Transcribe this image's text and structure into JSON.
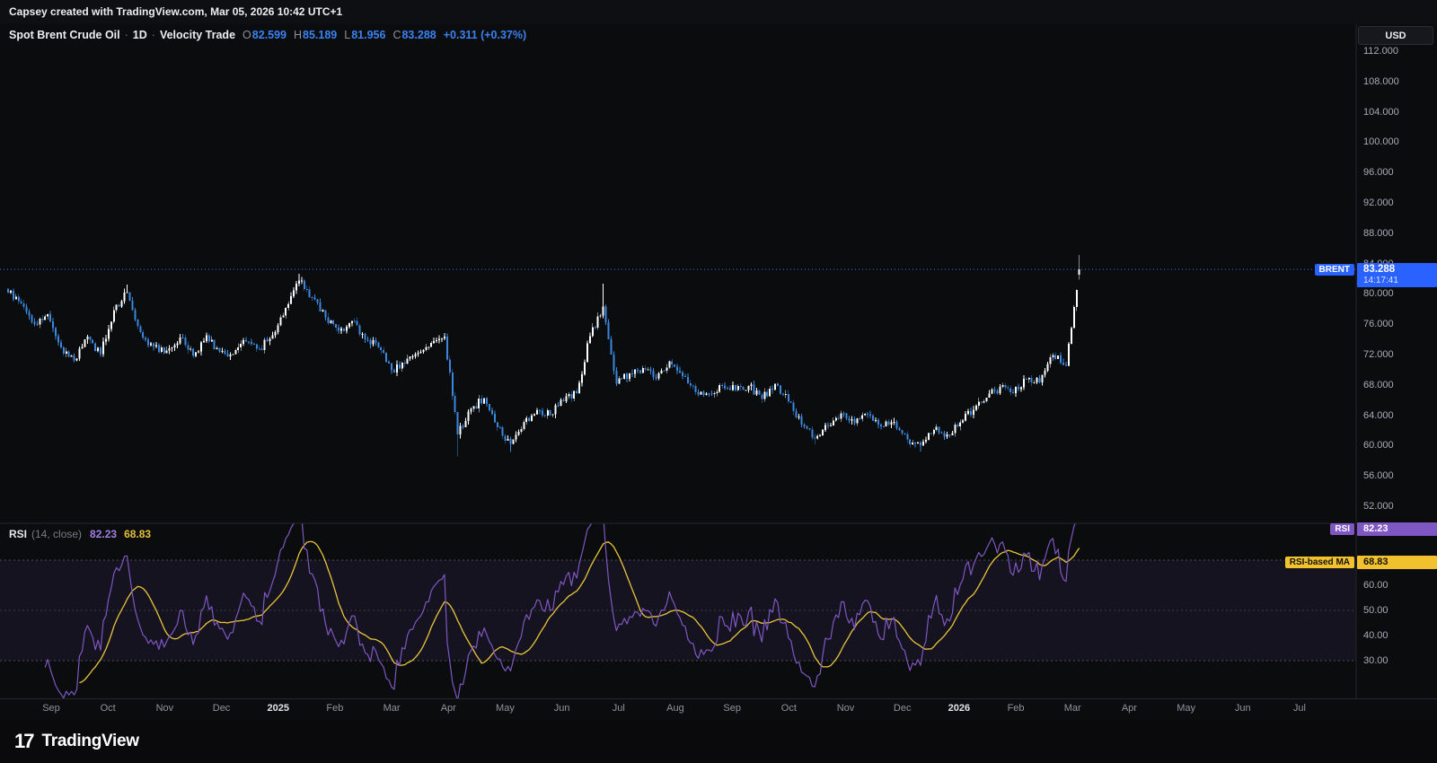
{
  "topbar": {
    "text": "Capsey created with TradingView.com, Mar 05, 2026 10:42 UTC+1"
  },
  "legend": {
    "symbol": "Spot Brent Crude Oil",
    "sep": "·",
    "interval": "1D",
    "exchange": "Velocity Trade",
    "ohlc": {
      "o_label": "O",
      "o": "82.599",
      "h_label": "H",
      "h": "85.189",
      "l_label": "L",
      "l": "81.956",
      "c_label": "C",
      "c": "83.288",
      "change": "+0.311 (+0.37%)"
    }
  },
  "currency_button": {
    "label": "USD"
  },
  "price_label": {
    "tag": "BRENT",
    "value": "83.288",
    "countdown": "14:17:41"
  },
  "rsi_pane": {
    "title": "RSI",
    "params": "(14, close)",
    "value": "82.23",
    "ma_value": "68.83",
    "label_tag": "RSI",
    "ma_label_tag": "RSI-based MA"
  },
  "footer": {
    "logo_mark": "17",
    "logo_text": "TradingView"
  },
  "chart_data": {
    "type": "candlestick",
    "title": "Spot Brent Crude Oil, 1D, Velocity Trade",
    "x_span": "Aug 2024 - Mar 2026 daily bars, empty future space to Jul 2026",
    "price_axis_ticks": [
      112,
      108,
      104,
      100,
      96,
      92,
      88,
      84,
      80,
      76,
      72,
      68,
      64,
      60,
      56,
      52
    ],
    "price_axis_visible_range": [
      52,
      112
    ],
    "current_price": 83.288,
    "last_bar": {
      "open": 82.599,
      "high": 85.189,
      "low": 81.956,
      "close": 83.288
    },
    "anchor_resolution": "weekly closes, interpolated to daily bars for rendering",
    "weekly_closes": [
      80.2,
      78.8,
      76.1,
      77.4,
      73.0,
      71.3,
      74.4,
      72.1,
      77.9,
      80.3,
      75.0,
      73.1,
      72.6,
      74.3,
      71.9,
      74.6,
      72.5,
      72.1,
      73.8,
      72.8,
      74.6,
      78.2,
      81.8,
      79.6,
      77.0,
      75.2,
      76.5,
      74.1,
      73.0,
      70.0,
      70.9,
      72.3,
      73.6,
      74.4,
      61.5,
      64.9,
      66.3,
      62.5,
      60.3,
      63.2,
      64.7,
      64.1,
      65.9,
      67.0,
      74.5,
      78.4,
      68.2,
      69.6,
      70.3,
      68.9,
      71.2,
      69.2,
      67.1,
      66.9,
      68.0,
      67.4,
      67.9,
      66.2,
      68.2,
      65.9,
      62.8,
      61.0,
      62.7,
      64.3,
      63.0,
      64.2,
      62.6,
      63.2,
      60.9,
      60.1,
      62.1,
      61.5,
      63.1,
      64.8,
      66.4,
      67.8,
      67.0,
      68.8,
      68.4,
      72.0,
      70.6,
      83.288
    ],
    "wick_overrides": {
      "9": {
        "h": 81.3
      },
      "22": {
        "h": 82.7
      },
      "34": {
        "l": 58.6
      },
      "38": {
        "l": 59.2
      },
      "45": {
        "h": 81.4
      },
      "61": {
        "l": 60.2
      },
      "69": {
        "l": 59.3
      }
    },
    "rsi": {
      "type": "line",
      "period": 14,
      "last": 82.23,
      "ma_period": 14,
      "ma_last": 68.83,
      "bands": [
        70,
        50,
        30
      ],
      "axis_ticks": [
        60,
        50,
        40,
        30
      ]
    },
    "time_axis_labels": [
      {
        "t": "Sep"
      },
      {
        "t": "Oct"
      },
      {
        "t": "Nov"
      },
      {
        "t": "Dec"
      },
      {
        "t": "2025",
        "year": true
      },
      {
        "t": "Feb"
      },
      {
        "t": "Mar"
      },
      {
        "t": "Apr"
      },
      {
        "t": "May"
      },
      {
        "t": "Jun"
      },
      {
        "t": "Jul"
      },
      {
        "t": "Aug"
      },
      {
        "t": "Sep"
      },
      {
        "t": "Oct"
      },
      {
        "t": "Nov"
      },
      {
        "t": "Dec"
      },
      {
        "t": "2026",
        "year": true
      },
      {
        "t": "Feb"
      },
      {
        "t": "Mar"
      },
      {
        "t": "Apr"
      },
      {
        "t": "May"
      },
      {
        "t": "Jun"
      },
      {
        "t": "Jul"
      }
    ],
    "colors": {
      "up": "#ffffff",
      "down": "#3a87dd",
      "accent_blue": "#2962ff",
      "price_line": "#3b7ae0",
      "rsi": "#7e57c2",
      "rsi_ma": "#e8c53a",
      "band_fill": "rgba(126,87,194,0.10)",
      "band_line": "#4c4c56",
      "mid_line": "#3e3e47",
      "separator": "#24262c"
    }
  }
}
